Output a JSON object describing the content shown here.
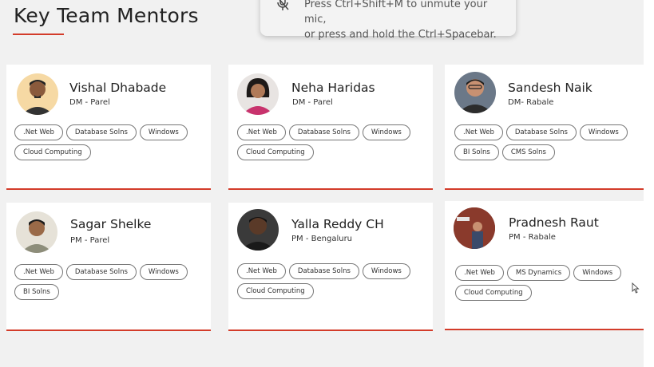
{
  "section": {
    "title": "Key Team Mentors"
  },
  "toast": {
    "line1": "Press Ctrl+Shift+M to unmute your mic,",
    "line2": "or press and hold the Ctrl+Spacebar."
  },
  "mentors": [
    {
      "name": "Vishal Dhabade",
      "role": "DM - Parel",
      "tags": [
        ".Net Web",
        "Database Solns",
        "Windows",
        "Cloud Computing"
      ]
    },
    {
      "name": "Neha Haridas",
      "role": "DM - Parel",
      "tags": [
        ".Net Web",
        "Database Solns",
        "Windows",
        "Cloud Computing"
      ]
    },
    {
      "name": "Sandesh Naik",
      "role": "DM- Rabale",
      "tags": [
        ".Net Web",
        "Database Solns",
        "Windows",
        "BI Solns",
        "CMS Solns"
      ]
    },
    {
      "name": "Sagar Shelke",
      "role": "PM - Parel",
      "tags": [
        ".Net Web",
        "Database Solns",
        "Windows",
        "BI Solns"
      ]
    },
    {
      "name": "Yalla Reddy CH",
      "role": "PM - Bengaluru",
      "tags": [
        ".Net Web",
        "Database Solns",
        "Windows",
        "Cloud Computing"
      ]
    },
    {
      "name": "Pradnesh Raut",
      "role": "PM - Rabale",
      "tags": [
        ".Net Web",
        "MS Dynamics",
        "Windows",
        "Cloud Computing"
      ]
    }
  ]
}
